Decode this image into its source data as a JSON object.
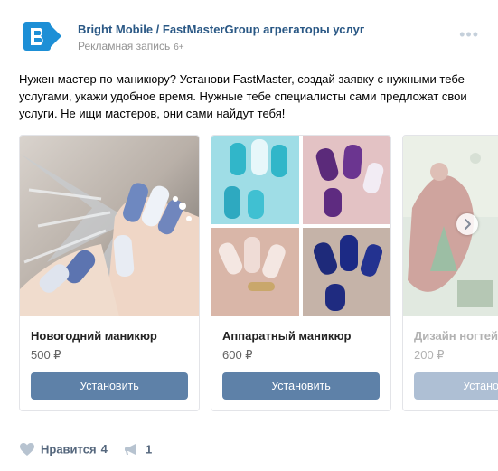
{
  "post": {
    "author": "Bright Mobile / FastMasterGroup агрегаторы услуг",
    "subtitle": "Рекламная запись",
    "age_rating": "6+",
    "text": "Нужен мастер по маникюру? Установи FastMaster, создай заявку с нужными тебе услугами, укажи удобное время. Нужные тебе специалисты сами предложат свои услуги. Не ищи мастеров, они сами найдут тебя!"
  },
  "cards": [
    {
      "title": "Новогодний маникюр",
      "price": "500 ₽",
      "button": "Установить",
      "image": "winter-manicure-photo"
    },
    {
      "title": "Аппаратный маникюр",
      "price": "600 ₽",
      "button": "Установить",
      "image": "nail-collage-photo"
    },
    {
      "title": "Дизайн ногтей",
      "price": "200 ₽",
      "button": "Установить",
      "image": "nail-design-photo"
    }
  ],
  "actions": {
    "like_label": "Нравится",
    "like_count": "4",
    "share_count": "1"
  },
  "icons": {
    "more": "more-dots-icon",
    "next": "chevron-right-icon",
    "like": "heart-icon",
    "share": "megaphone-icon"
  },
  "colors": {
    "link": "#2a5885",
    "button": "#5e81a8",
    "muted": "#939393",
    "action": "#55677d"
  }
}
